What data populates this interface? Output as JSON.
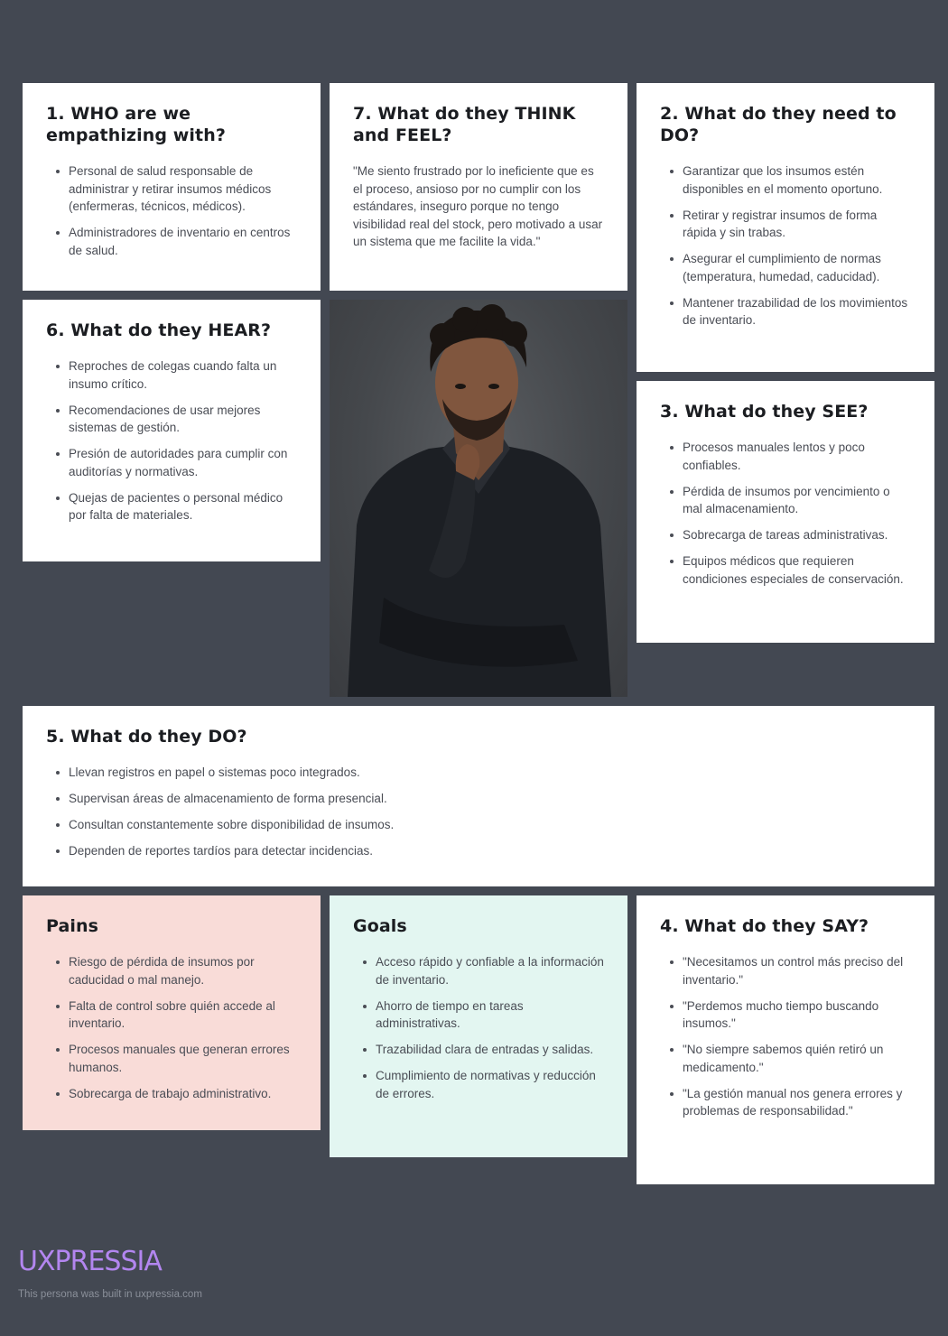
{
  "who": {
    "title": "1. WHO are we empathizing with?",
    "items": [
      "Personal de salud responsable de administrar y retirar insumos médicos (enfermeras, técnicos, médicos).",
      "Administradores de inventario en centros de salud."
    ]
  },
  "think_feel": {
    "title": "7. What do they THINK and FEEL?",
    "quote": "\"Me siento frustrado por lo ineficiente que es el proceso, ansioso por no cumplir con los estándares, inseguro porque no tengo visibilidad real del stock, pero motivado a usar un sistema que me facilite la vida.\""
  },
  "need_to_do": {
    "title": "2. What do they need to DO?",
    "items": [
      "Garantizar que los insumos estén disponibles en el momento oportuno.",
      "Retirar y registrar insumos de forma rápida y sin trabas.",
      "Asegurar el cumplimiento de normas (temperatura, humedad, caducidad).",
      "Mantener trazabilidad de los movimientos de inventario."
    ]
  },
  "hear": {
    "title": "6. What do they HEAR?",
    "items": [
      "Reproches de colegas cuando falta un insumo crítico.",
      "Recomendaciones de usar mejores sistemas de gestión.",
      "Presión de autoridades para cumplir con auditorías y normativas.",
      "Quejas de pacientes o personal médico por falta de materiales."
    ]
  },
  "see": {
    "title": "3. What do they SEE?",
    "items": [
      "Procesos manuales lentos y poco confiables.",
      "Pérdida de insumos por vencimiento o mal almacenamiento.",
      "Sobrecarga de tareas administrativas.",
      "Equipos médicos que requieren condiciones especiales de conservación."
    ]
  },
  "do": {
    "title": "5. What do they DO?",
    "items": [
      "Llevan registros en papel o sistemas poco integrados.",
      "Supervisan áreas de almacenamiento de forma presencial.",
      "Consultan constantemente sobre disponibilidad de insumos.",
      "Dependen de reportes tardíos para detectar incidencias."
    ]
  },
  "pains": {
    "title": "Pains",
    "items": [
      "Riesgo de pérdida de insumos por caducidad o mal manejo.",
      "Falta de control sobre quién accede al inventario.",
      "Procesos manuales que generan errores humanos.",
      "Sobrecarga de trabajo administrativo."
    ]
  },
  "goals": {
    "title": "Goals",
    "items": [
      "Acceso rápido y confiable a la información de inventario.",
      "Ahorro de tiempo en tareas administrativas.",
      "Trazabilidad clara de entradas y salidas.",
      "Cumplimiento de normativas y reducción de errores."
    ]
  },
  "say": {
    "title": "4. What do they SAY?",
    "items": [
      "\"Necesitamos un control más preciso del inventario.\"",
      "\"Perdemos mucho tiempo buscando insumos.\"",
      "\"No siempre sabemos quién retiró un medicamento.\"",
      "\"La gestión manual nos genera errores y problemas de responsabilidad.\""
    ]
  },
  "footer": {
    "logo": "UXPRESSIA",
    "note": "This persona was built in uxpressia.com"
  },
  "colors": {
    "background": "#434852",
    "pains_bg": "#f9dcd8",
    "goals_bg": "#e3f6f1",
    "logo": "#b386f0"
  }
}
